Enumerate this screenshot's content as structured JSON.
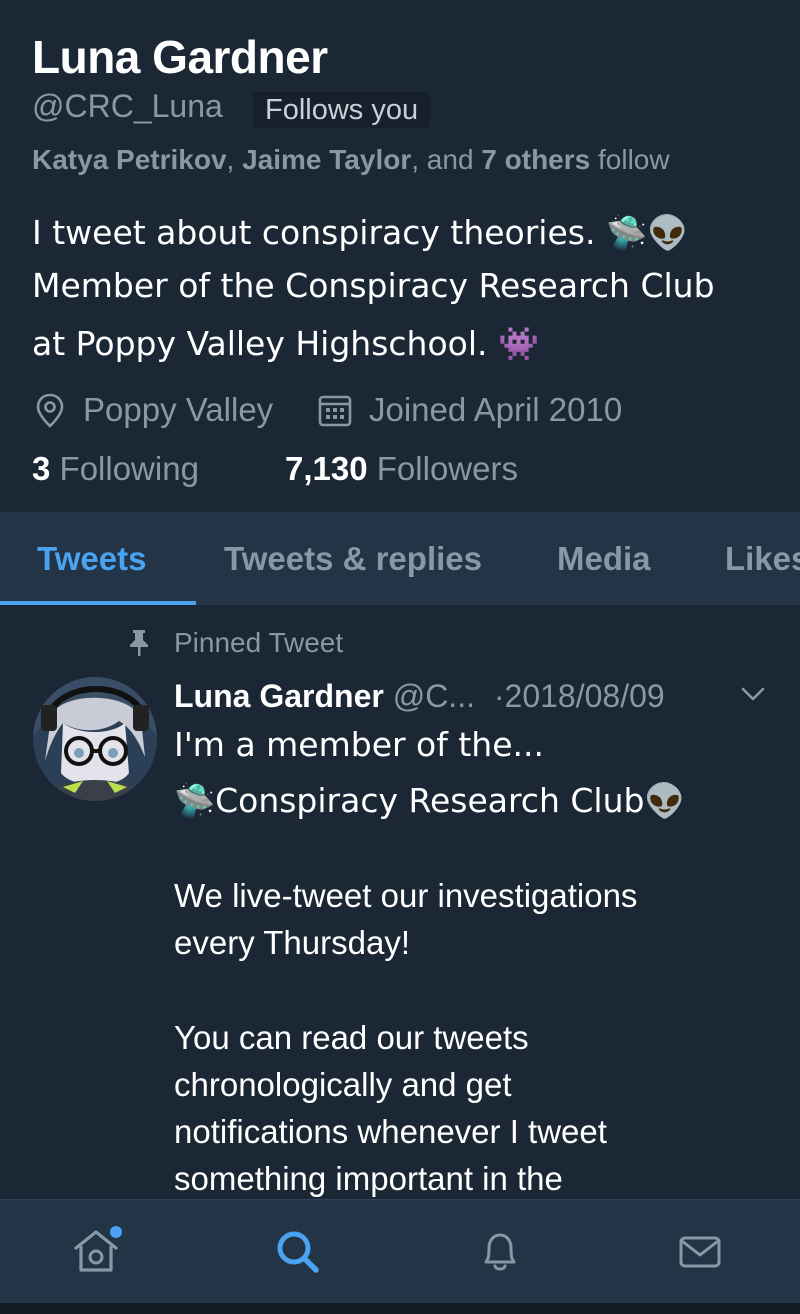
{
  "profile": {
    "display_name": "Luna Gardner",
    "handle": "@CRC_Luna",
    "follows_you_badge": "Follows you",
    "followed_by": {
      "name1": "Katya Petrikov",
      "sep1": ", ",
      "name2": "Jaime Taylor",
      "sep2": ", and ",
      "others": "7 others",
      "suffix": " follow"
    },
    "bio_lines": [
      "I tweet about conspiracy theories. 🛸👽",
      "Member of the Conspiracy Research Club",
      "at Poppy Valley Highschool. 👾"
    ],
    "location": "Poppy Valley",
    "joined": "Joined April 2010",
    "following_count": "3",
    "following_label": "Following",
    "followers_count": "7,130",
    "followers_label": "Followers"
  },
  "tabs": [
    {
      "label": "Tweets",
      "active": true
    },
    {
      "label": "Tweets & replies",
      "active": false
    },
    {
      "label": "Media",
      "active": false
    },
    {
      "label": "Likes",
      "active": false
    }
  ],
  "pinned_tweet": {
    "pinned_label": "Pinned Tweet",
    "author_name": "Luna Gardner",
    "author_handle": "@C...",
    "date": "·2018/08/09",
    "body_lines": [
      "I'm a member of the...",
      "🛸Conspiracy Research Club👽",
      "",
      "We live-tweet our investigations",
      "every Thursday!",
      "",
      "You can read our tweets",
      "chronologically and get",
      "notifications whenever I tweet",
      "something important in the"
    ]
  },
  "bottom_nav": {
    "items": [
      "home-icon",
      "search-icon",
      "notifications-icon",
      "messages-icon"
    ],
    "active": "search-icon",
    "home_has_badge": true
  },
  "colors": {
    "background": "#1b2735",
    "bar_background": "#243447",
    "accent": "#4aa3f0",
    "secondary_text": "#8899a6"
  }
}
